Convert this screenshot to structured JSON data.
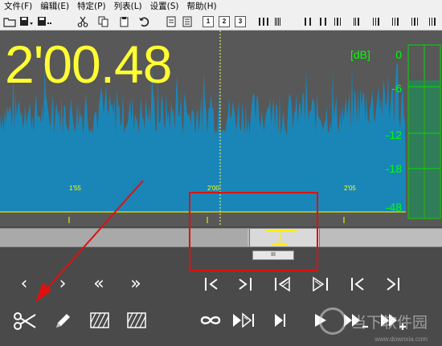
{
  "menu": {
    "items": [
      "文件(F)",
      "编辑(E)",
      "特定(P)",
      "列表(L)",
      "设置(S)",
      "帮助(H)"
    ]
  },
  "toolbar": {
    "icons": [
      "open-folder-icon",
      "save-icon",
      "save-all-icon",
      "cut-icon",
      "copy-icon",
      "paste-icon",
      "undo-icon",
      "mode-1-icon",
      "mode-2-icon",
      "mode-3-icon",
      "marker-icons"
    ],
    "mode_labels": [
      "1",
      "2",
      "3"
    ]
  },
  "display": {
    "timecode": "2'00.48",
    "ruler_ticks": [
      "1'55",
      "2'00",
      "2'05"
    ]
  },
  "meter": {
    "title": "[dB]",
    "levels": [
      "0",
      "-6",
      "-12",
      "-18",
      "-48"
    ]
  },
  "scroll": {
    "handle_label": "III"
  },
  "controls": {
    "row1": [
      "‹",
      "›",
      "«",
      "»"
    ],
    "icons_row1": [
      "prev-icon",
      "next-icon",
      "rewind-icon",
      "fast-forward-icon",
      "marker-left-icon",
      "marker-right-icon",
      "select-left-icon",
      "select-right-icon",
      "go-start-icon",
      "go-end-icon"
    ],
    "icons_row2": [
      "scissors-icon",
      "pencil-icon",
      "fade-in-icon",
      "fade-out-icon",
      "loop-icon",
      "play-selection-icon",
      "play-to-marker-icon",
      "play-icon",
      "volume-down-icon",
      "volume-up-icon"
    ]
  },
  "watermark": {
    "text": "当下软件园",
    "sub": "www.downxia.com"
  },
  "colors": {
    "wave": "#1a86b8",
    "timecode": "#ffff33",
    "meter": "#00ff00",
    "highlight": "#e01010"
  }
}
